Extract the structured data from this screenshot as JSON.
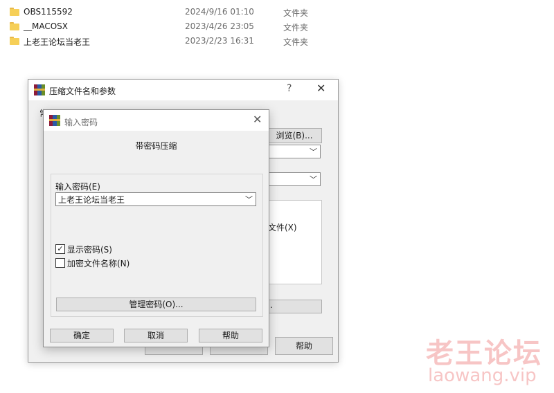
{
  "files": [
    {
      "name": "OBS115592",
      "date": "2024/9/16 01:10",
      "type": "文件夹"
    },
    {
      "name": "__MACOSX",
      "date": "2023/4/26 23:05",
      "type": "文件夹"
    },
    {
      "name": "上老王论坛当老王",
      "date": "2023/2/23 16:31",
      "type": "文件夹"
    }
  ],
  "back_dialog": {
    "title": "压缩文件名和参数",
    "help_glyph": "?",
    "close_glyph": "✕",
    "tab_hint": "常",
    "browse_label": "浏览(B)...",
    "files_text": "文件(X)",
    "strip_text": ".",
    "help_button": "帮助"
  },
  "password_dialog": {
    "title": "输入密码",
    "close_glyph": "✕",
    "subtitle": "带密码压缩",
    "password_label": "输入密码(E)",
    "password_value": "上老王论坛当老王",
    "show_password": {
      "label": "显示密码(S)",
      "checked": true,
      "mark": "✓"
    },
    "encrypt_names": {
      "label": "加密文件名称(N)",
      "checked": false
    },
    "manage_label": "管理密码(O)...",
    "ok_label": "确定",
    "cancel_label": "取消",
    "help_label": "帮助"
  },
  "icons": {
    "folder": "folder-icon",
    "app": "winrar-icon",
    "dropdown": "chevron-down-icon",
    "close": "close-icon"
  },
  "watermark": {
    "cn": "老王论坛",
    "en": "laowang.vip"
  }
}
